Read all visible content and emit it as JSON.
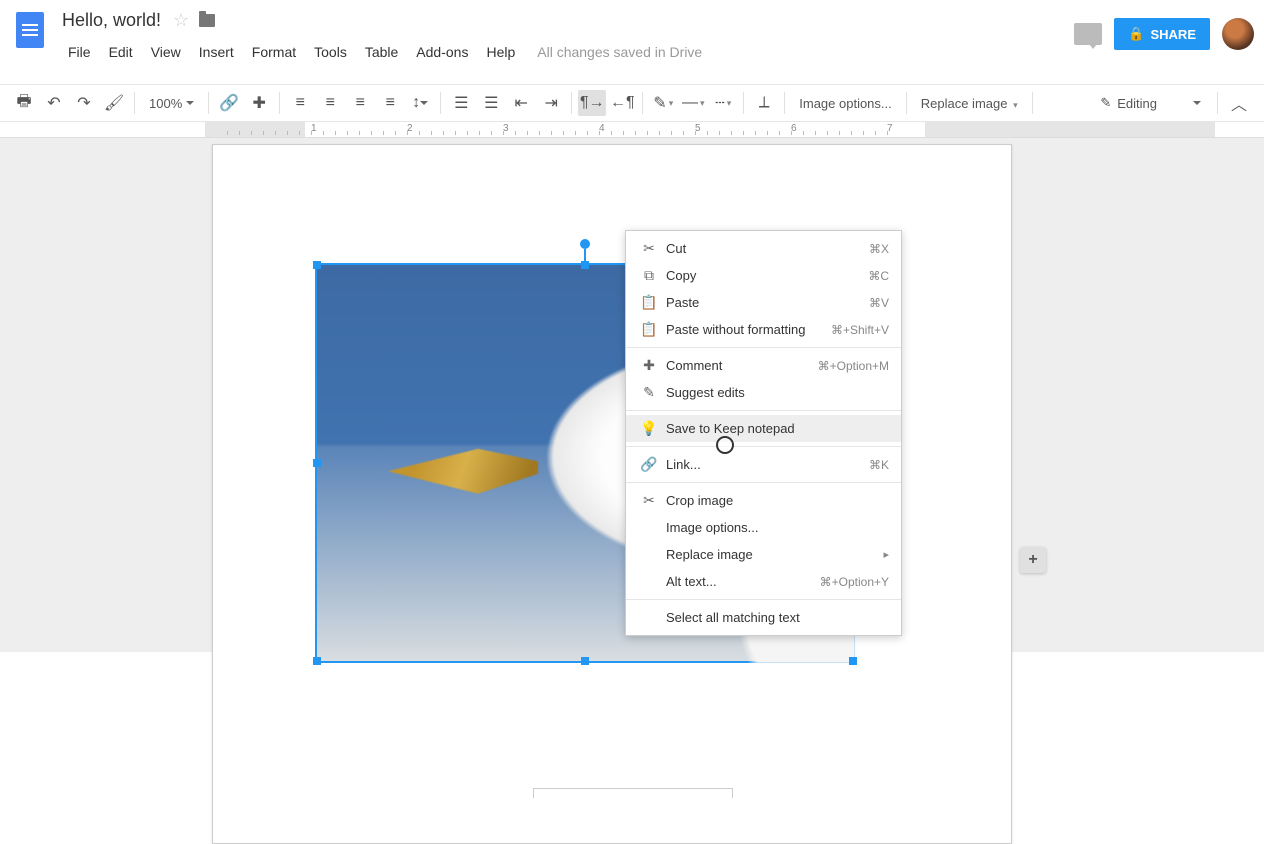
{
  "doc": {
    "title": "Hello, world!",
    "save_status": "All changes saved in Drive",
    "zoom": "100%",
    "editing_mode": "Editing",
    "image_options": "Image options...",
    "replace_image": "Replace image"
  },
  "menus": [
    "File",
    "Edit",
    "View",
    "Insert",
    "Format",
    "Tools",
    "Table",
    "Add-ons",
    "Help"
  ],
  "share": {
    "label": "SHARE"
  },
  "ruler_nums": [
    1,
    2,
    3,
    4,
    5,
    6,
    7
  ],
  "context_menu": {
    "items": [
      {
        "icon": "cut-icon",
        "glyph": "✂",
        "label": "Cut",
        "shortcut": "⌘X"
      },
      {
        "icon": "copy-icon",
        "glyph": "⧉",
        "label": "Copy",
        "shortcut": "⌘C"
      },
      {
        "icon": "paste-icon",
        "glyph": "📋",
        "label": "Paste",
        "shortcut": "⌘V"
      },
      {
        "icon": "paste-plain-icon",
        "glyph": "📋",
        "label": "Paste without formatting",
        "shortcut": "⌘+Shift+V"
      },
      {
        "sep": true
      },
      {
        "icon": "comment-icon",
        "glyph": "✚",
        "label": "Comment",
        "shortcut": "⌘+Option+M"
      },
      {
        "icon": "suggest-icon",
        "glyph": "✎",
        "label": "Suggest edits",
        "shortcut": ""
      },
      {
        "sep": true
      },
      {
        "icon": "keep-icon",
        "glyph": "💡",
        "label": "Save to Keep notepad",
        "shortcut": "",
        "hover": true
      },
      {
        "sep": true
      },
      {
        "icon": "link-icon",
        "glyph": "🔗",
        "label": "Link...",
        "shortcut": "⌘K"
      },
      {
        "sep": true
      },
      {
        "icon": "crop-icon",
        "glyph": "✂",
        "label": "Crop image",
        "shortcut": ""
      },
      {
        "icon": "",
        "glyph": "",
        "label": "Image options...",
        "shortcut": ""
      },
      {
        "icon": "",
        "glyph": "",
        "label": "Replace image",
        "shortcut": "",
        "submenu": true
      },
      {
        "icon": "",
        "glyph": "",
        "label": "Alt text...",
        "shortcut": "⌘+Option+Y"
      },
      {
        "sep": true
      },
      {
        "icon": "",
        "glyph": "",
        "label": "Select all matching text",
        "shortcut": ""
      }
    ]
  }
}
